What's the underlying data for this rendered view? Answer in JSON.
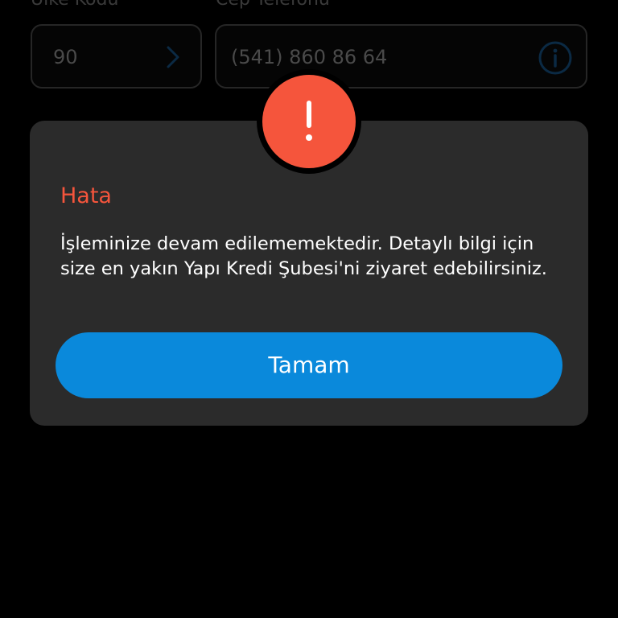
{
  "form": {
    "country_code_label": "Ülke Kodu",
    "country_code_value": "90",
    "phone_label": "Cep Telefonu",
    "phone_value": "(541) 860 86 64"
  },
  "dialog": {
    "title": "Hata",
    "message": "İşleminize devam edilememektedir. Detaylı bilgi için size en yakın Yapı Kredi Şubesi'ni ziyaret edebilirsiniz.",
    "ok_label": "Tamam",
    "icon": "exclamation-icon"
  },
  "colors": {
    "background": "#000000",
    "dialog_background": "#2b2b2b",
    "error": "#f5553c",
    "primary_button": "#0a89db",
    "text": "#ffffff"
  }
}
